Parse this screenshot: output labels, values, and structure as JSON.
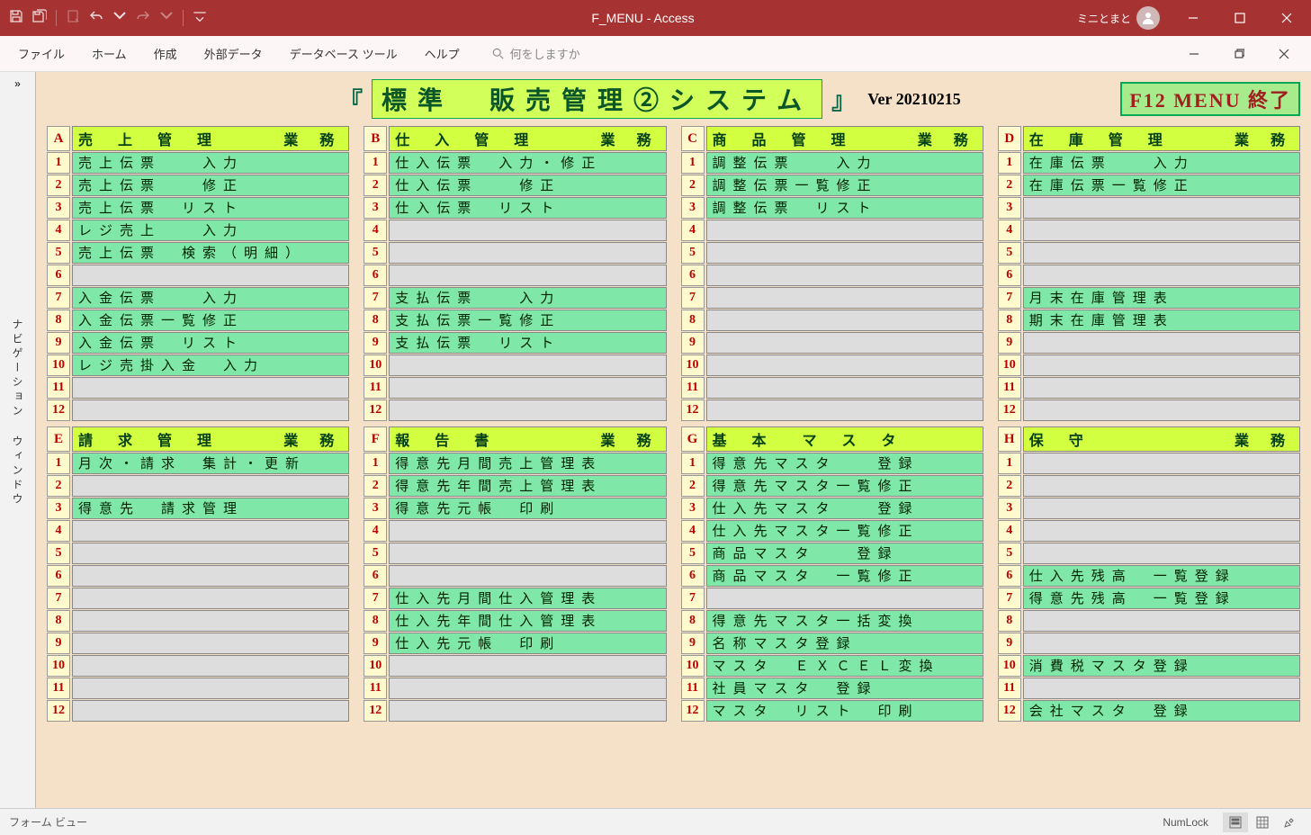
{
  "window": {
    "title": "F_MENU - Access",
    "user": "ミニとまと"
  },
  "menubar": {
    "items": [
      "ファイル",
      "ホーム",
      "作成",
      "外部データ",
      "データベース ツール",
      "ヘルプ"
    ],
    "search_placeholder": "何をしますか"
  },
  "nav": {
    "label": "ナビゲーション ウィンドウ",
    "toggle": "»"
  },
  "header": {
    "title": "標準　販売管理②システム",
    "ver": "Ver 20210215",
    "f12": "F12 MENU 終了"
  },
  "sections": [
    {
      "letter": "A",
      "title": "売 上 管 理",
      "tail": "業 務",
      "items": [
        "売上伝票　　入力",
        "売上伝票　　修正",
        "売上伝票　リスト",
        "レジ売上　　入力",
        "売上伝票　検索（明細）",
        "",
        "入金伝票　　入力",
        "入金伝票一覧修正",
        "入金伝票　リスト",
        "レジ売掛入金　入力",
        "",
        ""
      ]
    },
    {
      "letter": "B",
      "title": "仕 入 管 理",
      "tail": "業 務",
      "items": [
        "仕入伝票　入力・修正",
        "仕入伝票　　修正",
        "仕入伝票　リスト",
        "",
        "",
        "",
        "支払伝票　　入力",
        "支払伝票一覧修正",
        "支払伝票　リスト",
        "",
        "",
        ""
      ]
    },
    {
      "letter": "C",
      "title": "商 品 管 理",
      "tail": "業 務",
      "items": [
        "調整伝票　　入力",
        "調整伝票一覧修正",
        "調整伝票　リスト",
        "",
        "",
        "",
        "",
        "",
        "",
        "",
        "",
        ""
      ]
    },
    {
      "letter": "D",
      "title": "在 庫 管 理",
      "tail": "業 務",
      "items": [
        "在庫伝票　　入力",
        "在庫伝票一覧修正",
        "",
        "",
        "",
        "",
        "月末在庫管理表",
        "期末在庫管理表",
        "",
        "",
        "",
        ""
      ]
    },
    {
      "letter": "E",
      "title": "請 求 管 理",
      "tail": "業 務",
      "items": [
        "月次・請求　集計・更新",
        "",
        "得意先　請求管理",
        "",
        "",
        "",
        "",
        "",
        "",
        "",
        "",
        ""
      ]
    },
    {
      "letter": "F",
      "title": "報 告 書",
      "tail": "業 務",
      "items": [
        "得意先月間売上管理表",
        "得意先年間売上管理表",
        "得意先元帳　印刷",
        "",
        "",
        "",
        "仕入先月間仕入管理表",
        "仕入先年間仕入管理表",
        "仕入先元帳　印刷",
        "",
        "",
        ""
      ]
    },
    {
      "letter": "G",
      "title": "基 本　マ ス タ",
      "tail": "",
      "items": [
        "得意先マスタ　　登録",
        "得意先マスタ一覧修正",
        "仕入先マスタ　　登録",
        "仕入先マスタ一覧修正",
        "商品マスタ　　登録",
        "商品マスタ　一覧修正",
        "",
        "得意先マスタ一括変換",
        "名称マスタ登録",
        "マスタ　ＥＸＣＥＬ変換",
        "社員マスタ　登録",
        "マスタ　リスト　印刷"
      ]
    },
    {
      "letter": "H",
      "title": "保 守",
      "tail": "業 務",
      "items": [
        "",
        "",
        "",
        "",
        "",
        "仕入先残高　一覧登録",
        "得意先残高　一覧登録",
        "",
        "",
        "消費税マスタ登録",
        "",
        "会社マスタ　登録"
      ]
    }
  ],
  "statusbar": {
    "left": "フォーム ビュー",
    "numlock": "NumLock"
  }
}
